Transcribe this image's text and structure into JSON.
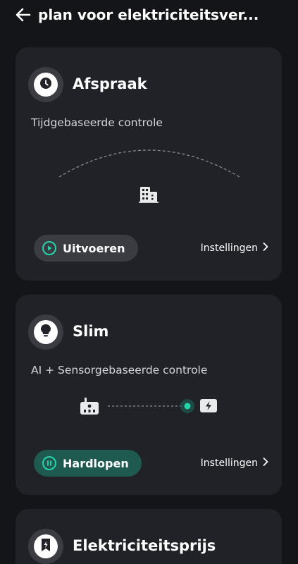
{
  "header": {
    "title": "plan voor elektriciteitsver..."
  },
  "cards": [
    {
      "title": "Afspraak",
      "subtitle": "Tijdgebaseerde controle",
      "action_label": "Uitvoeren",
      "settings_label": "Instellingen",
      "icon": "clock-icon",
      "illustration_icon": "building-icon"
    },
    {
      "title": "Slim",
      "subtitle": "AI + Sensorgebaseerde controle",
      "action_label": "Hardlopen",
      "settings_label": "Instellingen",
      "icon": "lightbulb-icon",
      "illustration_icons": [
        "meter-icon",
        "battery-charge-icon"
      ]
    },
    {
      "title": "Elektriciteitsprijs",
      "icon": "price-tag-icon"
    }
  ],
  "colors": {
    "background": "#141518",
    "card": "#202227",
    "accent": "#27d3a8",
    "pill_grey": "#3a3c42",
    "pill_green": "#1f5a50"
  }
}
